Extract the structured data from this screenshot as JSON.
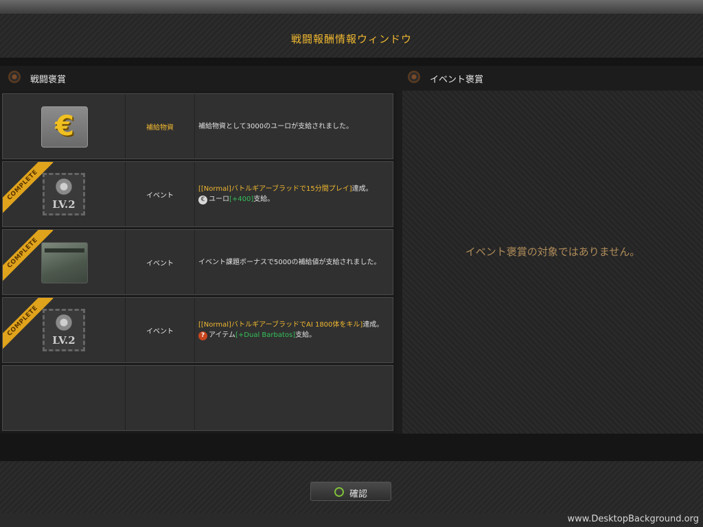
{
  "window": {
    "title": "戦闘報酬情報ウィンドウ"
  },
  "left_section": {
    "title": "戦闘褒賞"
  },
  "right_section": {
    "title": "イベント褒賞",
    "empty_message": "イベント褒賞の対象ではありません。"
  },
  "rows": [
    {
      "icon": "euro-coin-icon",
      "badge": "",
      "category": "補給物資",
      "description": "補給物資として3000のユーロが支給されました。"
    },
    {
      "icon": "lv2-medal-icon",
      "badge": "COMPLETE",
      "category": "イベント",
      "desc_part1": "[[Normal]バトルギアーブラッドで15分間プレイ]",
      "desc_part2": "達成。",
      "desc_part3": "ユーロ",
      "desc_part4": "[+400]",
      "desc_part5": "支給。"
    },
    {
      "icon": "supply-box-icon",
      "badge": "COMPLETE",
      "category": "イベント",
      "description": "イベント課題ボーナスで5000の補給値が支給されました。"
    },
    {
      "icon": "lv2-medal-icon",
      "badge": "COMPLETE",
      "category": "イベント",
      "desc_part1": "[[Normal]バトルギアーブラッドでAI 1800体をキル]",
      "desc_part2": "達成。",
      "desc_part3": "アイテム",
      "desc_part4": "[+Dual Barbatos]",
      "desc_part5": "支給。"
    }
  ],
  "icons": {
    "lv_label": "LV.2",
    "euro_symbol": "€",
    "euro_small": "€",
    "item_symbol": "?"
  },
  "confirm_button": {
    "label": "確認"
  },
  "watermark": "www.DesktopBackground.org",
  "colors": {
    "gold": "#f0b830",
    "green": "#35c05a",
    "accent_button": "#7fbf3a"
  }
}
